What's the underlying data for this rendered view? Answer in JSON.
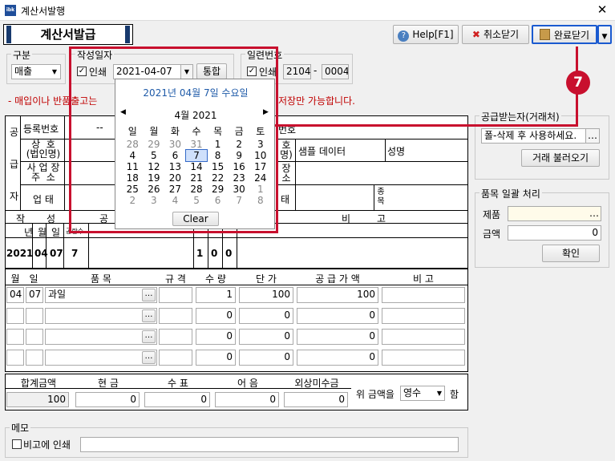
{
  "window": {
    "title": "계산서발행",
    "app_icon": "ibk",
    "close": "✕"
  },
  "form_title": "계산서발급",
  "toolbar": {
    "help": "Help[F1]",
    "cancel": "취소닫기",
    "complete": "완료닫기"
  },
  "category": {
    "label": "구분",
    "value": "매출"
  },
  "issue_date": {
    "label": "작성일자",
    "print_label": "인쇄",
    "value": "2021-04-07",
    "merge": "통합"
  },
  "serial": {
    "label": "일련번호",
    "print_label": "인쇄",
    "part1": "2104",
    "dash": "-",
    "part2": "0004"
  },
  "notice_prefix": "- 매입이나 반품출고는 ",
  "notice_suffix": "저장만 가능합니다.",
  "annotation_number": "7",
  "calendar": {
    "header": "2021년 04월 7일 수요일",
    "month": "4월 2021",
    "prev": "◀",
    "next": "▶",
    "weekdays": [
      "일",
      "월",
      "화",
      "수",
      "목",
      "금",
      "토"
    ],
    "weeks": [
      [
        "28",
        "29",
        "30",
        "31",
        "1",
        "2",
        "3"
      ],
      [
        "4",
        "5",
        "6",
        "7",
        "8",
        "9",
        "10"
      ],
      [
        "11",
        "12",
        "13",
        "14",
        "15",
        "16",
        "17"
      ],
      [
        "18",
        "19",
        "20",
        "21",
        "22",
        "23",
        "24"
      ],
      [
        "25",
        "26",
        "27",
        "28",
        "29",
        "30",
        "1"
      ],
      [
        "2",
        "3",
        "4",
        "5",
        "6",
        "7",
        "8"
      ]
    ],
    "clear": "Clear"
  },
  "supplier": {
    "side": [
      "공",
      "급",
      "자"
    ],
    "reg_no": "등록번호",
    "reg_no_value": "--",
    "name": "상  호\n(법인명)",
    "address": "사 업 장\n주  소",
    "business": "업  태"
  },
  "buyer": {
    "code_label": "번호",
    "name_label": "호\n명)",
    "name_value": "샘플 데이터",
    "rep_label": "성명",
    "address_label": "장\n소",
    "business_label": "태",
    "item_label": "종목"
  },
  "summary_row": {
    "labels": [
      "작",
      "성",
      "공",
      "비",
      "고"
    ],
    "sub": [
      "년",
      "월",
      "일",
      "공란수"
    ],
    "year": "2021",
    "month": "04",
    "day": "07",
    "blank": "7",
    "amount_digits": [
      "1",
      "0",
      "0"
    ]
  },
  "items": {
    "headers": [
      "월",
      "일",
      "품  목",
      "규 격",
      "수 량",
      "단 가",
      "공 급 가 액",
      "비  고"
    ],
    "rows": [
      {
        "month": "04",
        "day": "07",
        "name": "과일",
        "qty": "1",
        "price": "100",
        "amount": "100"
      },
      {
        "month": "",
        "day": "",
        "name": "",
        "qty": "0",
        "price": "0",
        "amount": "0"
      },
      {
        "month": "",
        "day": "",
        "name": "",
        "qty": "0",
        "price": "0",
        "amount": "0"
      },
      {
        "month": "",
        "day": "",
        "name": "",
        "qty": "0",
        "price": "0",
        "amount": "0"
      }
    ],
    "more": "…"
  },
  "totals": {
    "headers": [
      "합계금액",
      "현  금",
      "수  표",
      "어  음",
      "외상미수금"
    ],
    "values": [
      "100",
      "0",
      "0",
      "0",
      "0"
    ],
    "tail_prefix": "위 금액을",
    "receipt": "영수",
    "tail_suffix": "함"
  },
  "memo": {
    "label": "메모",
    "print_label": "비고에 인쇄",
    "value": ""
  },
  "right": {
    "partner_label": "공급받는자(거래처)",
    "partner_value": "폴-삭제 후 사용하세요.",
    "partner_more": "…",
    "load_btn": "거래 불러오기",
    "batch_label": "품목 일괄 처리",
    "product_label": "제품",
    "product_more": "…",
    "amount_label": "금액",
    "amount_value": "0",
    "confirm": "확인"
  },
  "colors": {
    "annotation": "#c8102e",
    "calendar_header": "#1e5aa8",
    "notice": "#c00000"
  }
}
